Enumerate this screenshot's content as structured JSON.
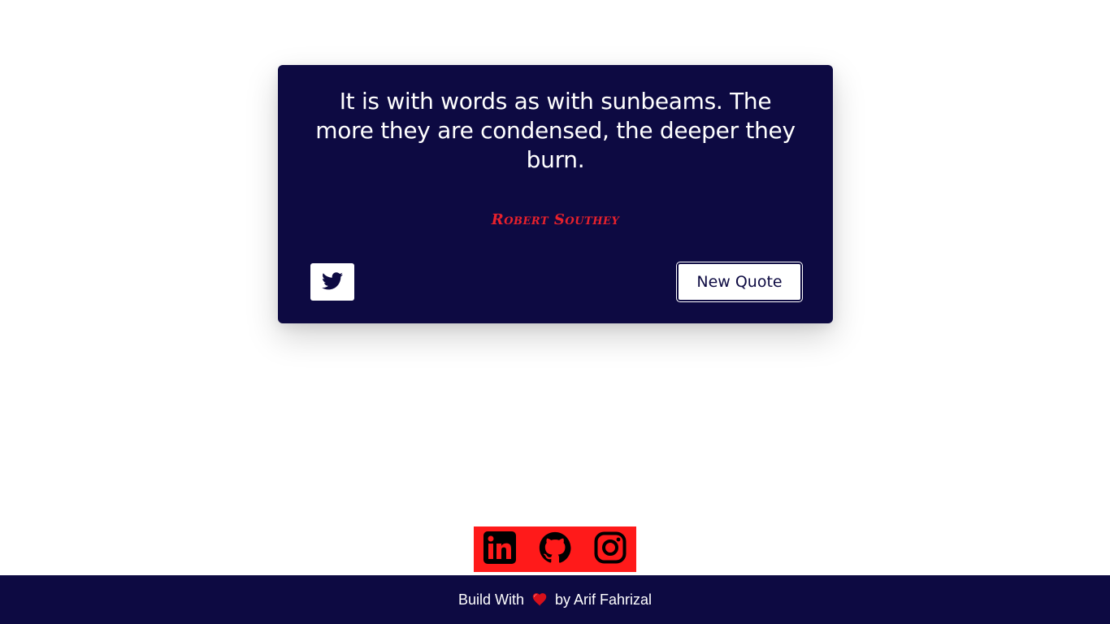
{
  "quote": {
    "text": "It is with words as with sunbeams. The more they are condensed, the deeper they burn.",
    "author": "Robert Southey",
    "tweet_icon": "twitter-icon",
    "new_quote_label": "New Quote"
  },
  "social": {
    "icons": [
      "linkedin-icon",
      "github-icon",
      "instagram-icon"
    ]
  },
  "footer": {
    "prefix": "Build With",
    "heart_icon": "heart-icon",
    "suffix": "by Arif Fahrizal"
  },
  "colors": {
    "card_background": "#0d0a42",
    "author_color": "#e8212c",
    "social_background": "#ff1a1a",
    "footer_background": "#0d0a42"
  }
}
